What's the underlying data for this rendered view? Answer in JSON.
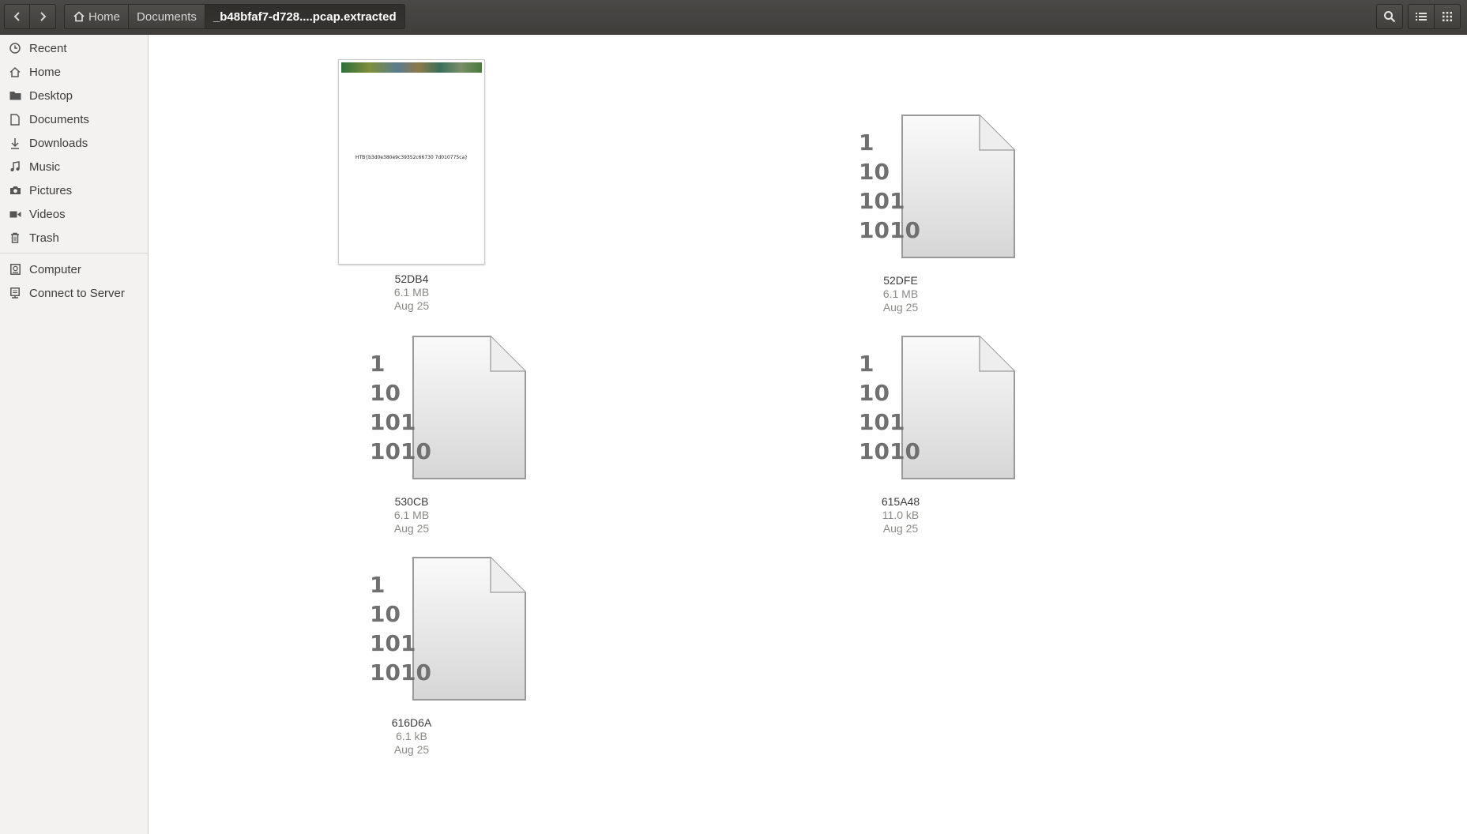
{
  "header": {
    "breadcrumbs": [
      {
        "label": "Home",
        "icon": "home-icon"
      },
      {
        "label": "Documents"
      },
      {
        "label": "_b48bfaf7-d728....pcap.extracted",
        "active": true
      }
    ]
  },
  "sidebar": {
    "items": [
      {
        "label": "Recent",
        "icon": "clock-icon"
      },
      {
        "label": "Home",
        "icon": "home-icon"
      },
      {
        "label": "Desktop",
        "icon": "folder-icon"
      },
      {
        "label": "Documents",
        "icon": "document-icon"
      },
      {
        "label": "Downloads",
        "icon": "download-icon"
      },
      {
        "label": "Music",
        "icon": "music-icon"
      },
      {
        "label": "Pictures",
        "icon": "camera-icon"
      },
      {
        "label": "Videos",
        "icon": "video-icon"
      },
      {
        "label": "Trash",
        "icon": "trash-icon"
      },
      {
        "label": "Computer",
        "icon": "computer-icon"
      },
      {
        "label": "Connect to Server",
        "icon": "server-icon"
      }
    ]
  },
  "files": [
    {
      "name": "52DB4",
      "size": "6.1 MB",
      "date": "Aug 25",
      "type": "image-thumbnail",
      "thumb_text": "HTB{b3d0e380e9c39352c66730 7d010775ca}"
    },
    {
      "name": "52DFE",
      "size": "6.1 MB",
      "date": "Aug 25",
      "type": "binary"
    },
    {
      "name": "530CB",
      "size": "6.1 MB",
      "date": "Aug 25",
      "type": "binary"
    },
    {
      "name": "615A48",
      "size": "11.0 kB",
      "date": "Aug 25",
      "type": "binary"
    },
    {
      "name": "616D6A",
      "size": "6.1 kB",
      "date": "Aug 25",
      "type": "binary"
    }
  ],
  "binary_icon_text": "1\n10\n101\n1010"
}
